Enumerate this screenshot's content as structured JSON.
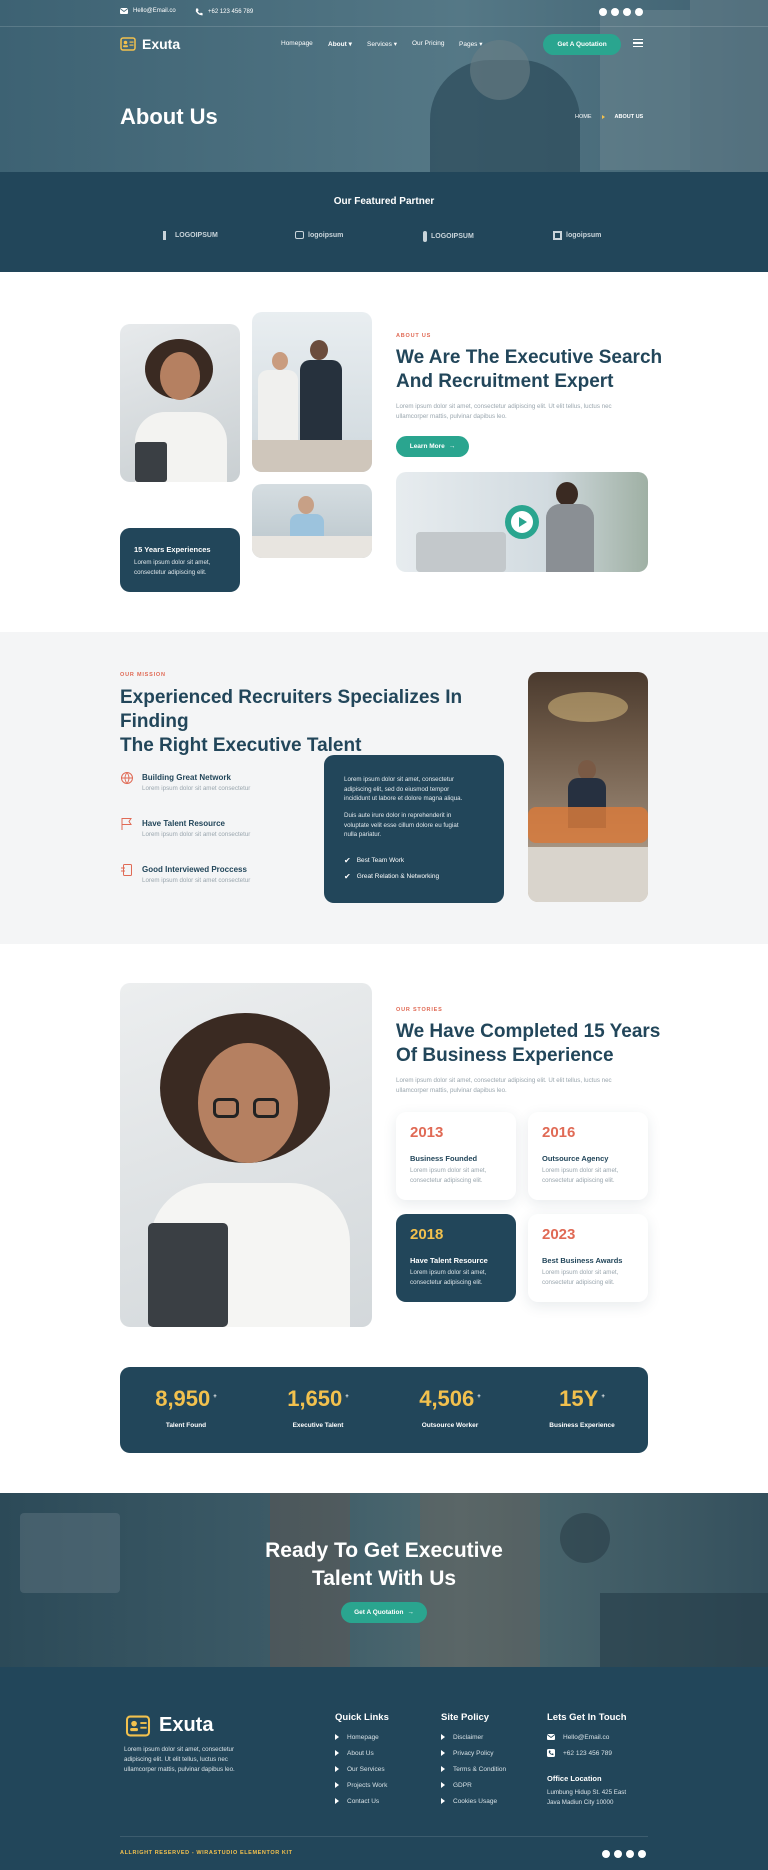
{
  "topbar": {
    "email": "Hello@Email.co",
    "phone": "+62 123 456 789"
  },
  "brand": {
    "name": "Exuta"
  },
  "nav": {
    "items": [
      "Homepage",
      "About",
      "Services",
      "Our Pricing",
      "Pages"
    ],
    "cta": "Get A Quotation"
  },
  "hero": {
    "title": "About Us",
    "breadcrumb_home": "HOME",
    "breadcrumb_current": "ABOUT US"
  },
  "partner": {
    "title": "Our Featured Partner",
    "logos": [
      "LOGOIPSUM",
      "logoipsum",
      "LOGOIPSUM",
      "logoipsum"
    ]
  },
  "about": {
    "kicker": "ABOUT US",
    "title_line1": "We Are The Executive Search",
    "title_line2": "And Recruitment Expert",
    "text_line1": "Lorem ipsum dolor sit amet, consectetur adipiscing elit. Ut elit tellus, luctus nec",
    "text_line2": "ullamcorper mattis, pulvinar dapibus leo.",
    "button": "Learn More",
    "badge_title": "15 Years Experiences",
    "badge_line1": "Lorem ipsum dolor sit amet,",
    "badge_line2": "consectetur adipiscing elit."
  },
  "mission": {
    "kicker": "OUR MISSION",
    "title_line1": "Experienced Recruiters Specializes In Finding",
    "title_line2": "The Right Executive Talent",
    "features": [
      {
        "title": "Building Great Network",
        "text": "Lorem ipsum dolor sit amet consectetur"
      },
      {
        "title": "Have Talent Resource",
        "text": "Lorem ipsum dolor sit amet consectetur"
      },
      {
        "title": "Good Interviewed Proccess",
        "text": "Lorem ipsum dolor sit amet consectetur"
      }
    ],
    "box_p1_l1": "Lorem ipsum dolor sit amet, consectetur",
    "box_p1_l2": "adipiscing elit, sed do eiusmod tempor",
    "box_p1_l3": "incididunt ut labore et dolore magna aliqua.",
    "box_p2_l1": "Duis aute irure dolor in reprehenderit in",
    "box_p2_l2": "voluptate velit esse cillum dolore eu fugiat",
    "box_p2_l3": "nulla pariatur.",
    "checks": [
      "Best Team Work",
      "Great Relation & Networking"
    ]
  },
  "stories": {
    "kicker": "OUR STORIES",
    "title_line1": "We Have Completed 15 Years",
    "title_line2": "Of Business Experience",
    "text_line1": "Lorem ipsum dolor sit amet, consectetur adipiscing elit. Ut elit tellus, luctus nec",
    "text_line2": "ullamcorper mattis, pulvinar dapibus leo.",
    "cards": [
      {
        "year": "2013",
        "title": "Business Founded",
        "l1": "Lorem ipsum dolor sit amet,",
        "l2": "consectetur adipiscing elit."
      },
      {
        "year": "2016",
        "title": "Outsource Agency",
        "l1": "Lorem ipsum dolor sit amet,",
        "l2": "consectetur adipiscing elit."
      },
      {
        "year": "2018",
        "title": "Have Talent Resource",
        "l1": "Lorem ipsum dolor sit amet,",
        "l2": "consectetur adipiscing elit."
      },
      {
        "year": "2023",
        "title": "Best Business Awards",
        "l1": "Lorem ipsum dolor sit amet,",
        "l2": "consectetur adipiscing elit."
      }
    ]
  },
  "stats": [
    {
      "value": "8,950",
      "label": "Talent Found"
    },
    {
      "value": "1,650",
      "label": "Executive Talent"
    },
    {
      "value": "4,506",
      "label": "Outsource Worker"
    },
    {
      "value": "15Y",
      "label": "Business Experience"
    }
  ],
  "stat_plus": "+",
  "cta": {
    "line1": "Ready To Get Executive",
    "line2": "Talent With Us",
    "button": "Get A Quotation"
  },
  "footer": {
    "about_l1": "Lorem ipsum dolor sit amet, consectetur",
    "about_l2": "adipiscing elit. Ut elit tellus, luctus nec",
    "about_l3": "ullamcorper mattis, pulvinar dapibus leo.",
    "quick_title": "Quick Links",
    "quick_links": [
      "Homepage",
      "About Us",
      "Our Services",
      "Projects Work",
      "Contact Us"
    ],
    "policy_title": "Site Policy",
    "policy_links": [
      "Disclaimer",
      "Privacy Policy",
      "Terms & Condition",
      "GDPR",
      "Cookies Usage"
    ],
    "touch_title": "Lets Get In Touch",
    "email": "Hello@Email.co",
    "phone": "+62 123 456 789",
    "office_title": "Office Location",
    "office_l1": "Lumbung Hidup St. 425 East",
    "office_l2": "Java Madiun City 10000",
    "copyright": "ALLRIGHT RESERVED - WIRASTUDIO ELEMENTOR KIT"
  },
  "colors": {
    "navy": "#22465a",
    "teal": "#2aa58f",
    "coral": "#e06a55",
    "gold": "#f2c14e"
  }
}
